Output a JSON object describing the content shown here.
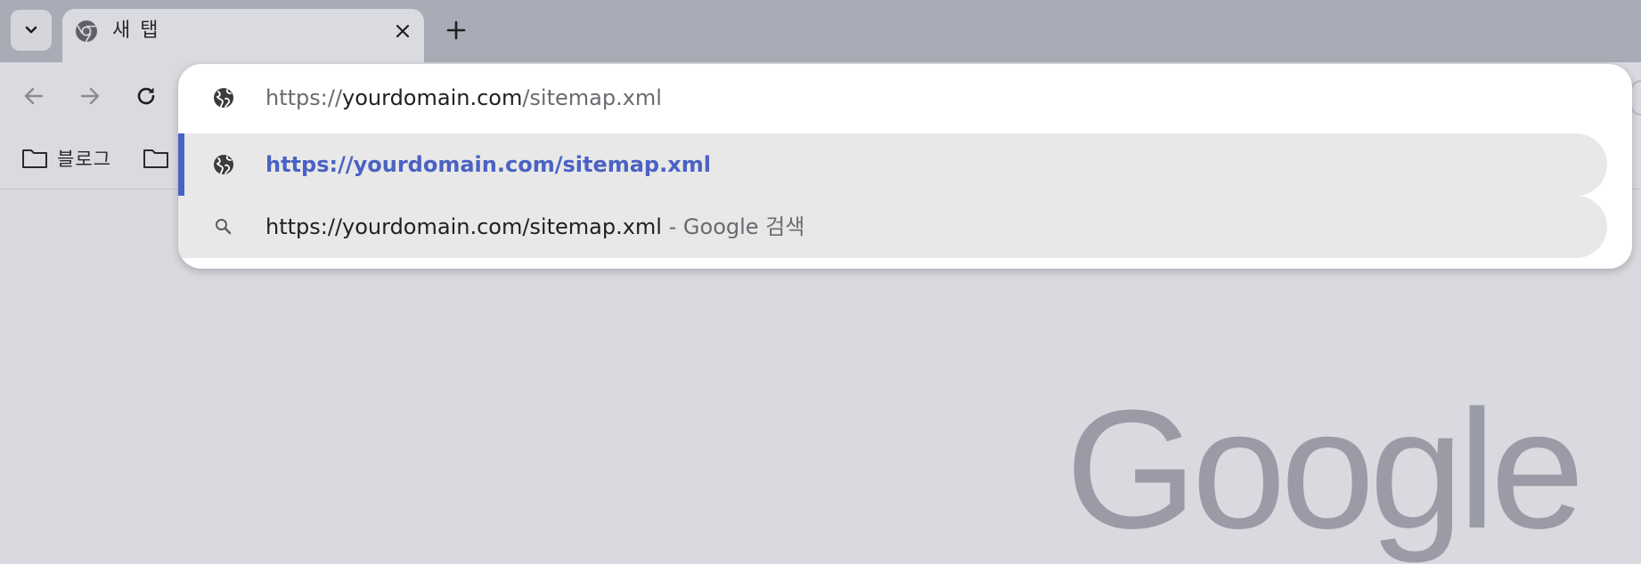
{
  "tabs": [
    {
      "title": "새 탭",
      "icon": "chrome-icon",
      "active": true
    }
  ],
  "omnibox": {
    "input": {
      "prefix": "https://",
      "domain": "yourdomain.com",
      "path": "/sitemap.xml"
    },
    "suggestions": [
      {
        "icon": "globe-icon",
        "text": "https://yourdomain.com/sitemap.xml",
        "selected": true
      },
      {
        "icon": "search-icon",
        "text": "https://yourdomain.com/sitemap.xml",
        "separator": " - ",
        "suffix": "Google 검색",
        "selected": false
      }
    ]
  },
  "bookmarks": [
    {
      "icon": "folder-icon",
      "label": "블로그"
    },
    {
      "icon": "folder-icon",
      "label": ""
    }
  ],
  "content": {
    "logo_text": "Google"
  },
  "colors": {
    "tabstrip": "#a9abb7",
    "toolbar": "#dadbe0",
    "accent": "#4a62c4",
    "suggestion_bg": "#e8e8e8",
    "logo": "#9a9ba6"
  }
}
